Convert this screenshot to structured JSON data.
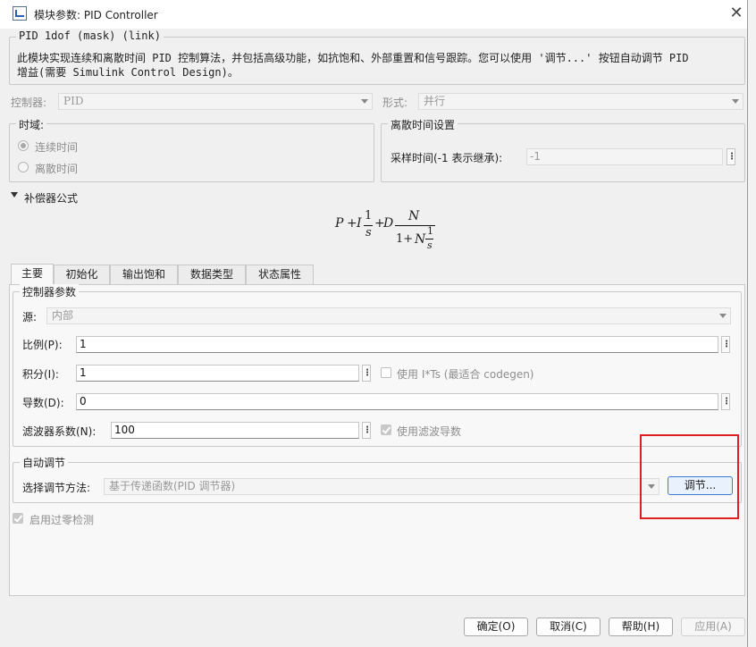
{
  "window": {
    "title": "模块参数: PID Controller"
  },
  "header": {
    "heading": "PID 1dof (mask) (link)",
    "description_line1": "此模块实现连续和离散时间 PID 控制算法，并包括高级功能，如抗饱和、外部重置和信号跟踪。您可以使用 '调节...' 按钮自动调节 PID",
    "description_line2": "增益(需要 Simulink Control Design)。"
  },
  "controller": {
    "label": "控制器:",
    "value": "PID"
  },
  "form": {
    "label": "形式:",
    "value": "并行"
  },
  "time_domain": {
    "legend": "时域:",
    "continuous": "连续时间",
    "discrete": "离散时间",
    "selected": "continuous"
  },
  "discrete_settings": {
    "legend": "离散时间设置",
    "sample_time_label": "采样时间(-1 表示继承):",
    "sample_time_value": "-1"
  },
  "compensator": {
    "label": "补偿器公式",
    "formula": {
      "P": "P",
      "plus": "+",
      "I": "I",
      "one": "1",
      "s": "s",
      "D": "D",
      "N": "N",
      "one_plus": "1+",
      "N2": "N"
    }
  },
  "tabs": [
    {
      "label": "主要",
      "active": true
    },
    {
      "label": "初始化",
      "active": false
    },
    {
      "label": "输出饱和",
      "active": false
    },
    {
      "label": "数据类型",
      "active": false
    },
    {
      "label": "状态属性",
      "active": false
    }
  ],
  "controller_params": {
    "legend": "控制器参数",
    "source_label": "源:",
    "source_value": "内部",
    "p_label": "比例(P):",
    "p_value": "1",
    "i_label": "积分(I):",
    "i_value": "1",
    "use_its_label": "使用 I*Ts (最适合 codegen)",
    "use_its_checked": false,
    "d_label": "导数(D):",
    "d_value": "0",
    "n_label": "滤波器系数(N):",
    "n_value": "100",
    "use_filter_label": "使用滤波导数",
    "use_filter_checked": true
  },
  "auto_tune": {
    "legend": "自动调节",
    "method_label": "选择调节方法:",
    "method_value": "基于传递函数(PID 调节器)",
    "tune_button": "调节..."
  },
  "zero_cross": {
    "label": "启用过零检测",
    "checked": true
  },
  "footer": {
    "ok": "确定(O)",
    "cancel": "取消(C)",
    "help": "帮助(H)",
    "apply": "应用(A)"
  },
  "colors": {
    "highlight": "#e02020",
    "accent": "#3a7bd5"
  }
}
